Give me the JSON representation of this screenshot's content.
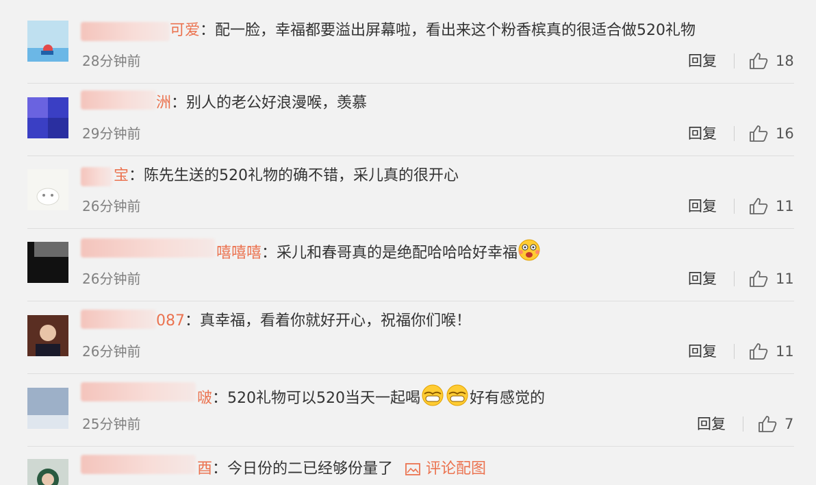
{
  "comments": [
    {
      "user_tail": "可爱",
      "separator": "：",
      "text": "配一脸，幸福都要溢出屏幕啦，看出来这个粉香槟真的很适合做520礼物",
      "time": "28分钟前",
      "reply": "回复",
      "likes": "18"
    },
    {
      "user_tail": "洲",
      "separator": "：",
      "text": "别人的老公好浪漫喉，羡慕",
      "time": "29分钟前",
      "reply": "回复",
      "likes": "16"
    },
    {
      "user_tail": "宝",
      "separator": "：",
      "text": "陈先生送的520礼物的确不错，采儿真的很开心",
      "time": "26分钟前",
      "reply": "回复",
      "likes": "11"
    },
    {
      "user_tail": "嘻嘻嘻",
      "separator": "：",
      "text": "采儿和春哥真的是绝配哈哈哈好幸福",
      "emoji": "shock-face-emoji",
      "time": "26分钟前",
      "reply": "回复",
      "likes": "11"
    },
    {
      "user_tail": "087",
      "separator": "：",
      "text": "真幸福，看着你就好开心，祝福你们喉！",
      "time": "26分钟前",
      "reply": "回复",
      "likes": "11"
    },
    {
      "user_tail": "啵",
      "separator": "：",
      "text": "520礼物可以520当天一起喝",
      "text_after": "好有感觉的",
      "emoji": "grin-face-emoji",
      "time": "25分钟前",
      "reply": "回复",
      "likes": "7"
    },
    {
      "user_tail": "酉",
      "separator": "：",
      "text": "今日份的二已经够份量了",
      "pic_link": "评论配图"
    }
  ],
  "colors": {
    "username": "#eb7350",
    "text": "#333333",
    "meta": "#808080",
    "background": "#f2f2f2"
  }
}
